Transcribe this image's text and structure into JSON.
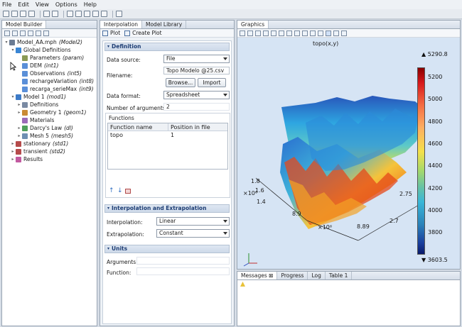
{
  "menu": [
    "File",
    "Edit",
    "View",
    "Options",
    "Help"
  ],
  "model_builder": {
    "tab": "Model Builder",
    "tree": [
      {
        "depth": 0,
        "twisty": "▾",
        "label": "Model_AA.mph",
        "tag": "(Model2)",
        "color": "#6b7c93"
      },
      {
        "depth": 1,
        "twisty": "▾",
        "label": "Global Definitions",
        "tag": "",
        "color": "#3a86d4"
      },
      {
        "depth": 2,
        "twisty": "",
        "label": "Parameters",
        "tag": "(param)",
        "color": "#8a9a55"
      },
      {
        "depth": 2,
        "twisty": "",
        "label": "DEM",
        "tag": "(int1)",
        "color": "#5a8fd8"
      },
      {
        "depth": 2,
        "twisty": "",
        "label": "Observations",
        "tag": "(int5)",
        "color": "#5a8fd8"
      },
      {
        "depth": 2,
        "twisty": "",
        "label": "rechargeVariation",
        "tag": "(int8)",
        "color": "#5a8fd8"
      },
      {
        "depth": 2,
        "twisty": "",
        "label": "recarga_serieMax",
        "tag": "(int9)",
        "color": "#5a8fd8"
      },
      {
        "depth": 1,
        "twisty": "▾",
        "label": "Model 1",
        "tag": "(mod1)",
        "color": "#3c7bc8"
      },
      {
        "depth": 2,
        "twisty": "▸",
        "label": "Definitions",
        "tag": "",
        "color": "#7a8aa3"
      },
      {
        "depth": 2,
        "twisty": "▸",
        "label": "Geometry 1",
        "tag": "(geom1)",
        "color": "#c98a34"
      },
      {
        "depth": 2,
        "twisty": "",
        "label": "Materials",
        "tag": "",
        "color": "#9b6bb8"
      },
      {
        "depth": 2,
        "twisty": "▸",
        "label": "Darcy's Law",
        "tag": "(dl)",
        "color": "#4f9f5b"
      },
      {
        "depth": 2,
        "twisty": "▸",
        "label": "Mesh 5",
        "tag": "(mesh5)",
        "color": "#6e8fb3"
      },
      {
        "depth": 1,
        "twisty": "▸",
        "label": "stationary",
        "tag": "(std1)",
        "color": "#b54b4b"
      },
      {
        "depth": 1,
        "twisty": "▸",
        "label": "transient",
        "tag": "(std2)",
        "color": "#b54b4b"
      },
      {
        "depth": 1,
        "twisty": "▸",
        "label": "Results",
        "tag": "",
        "color": "#c25aa0"
      }
    ]
  },
  "settings": {
    "tabs": [
      "Interpolation",
      "Model Library"
    ],
    "plot_label": "Plot",
    "create_plot_label": "Create Plot",
    "definition": {
      "header": "Definition",
      "data_source_label": "Data source:",
      "data_source_value": "File",
      "filename_label": "Filename:",
      "filename_value": "Topo Modelo @25.csv",
      "browse_label": "Browse...",
      "import_label": "Import",
      "data_format_label": "Data format:",
      "data_format_value": "Spreadsheet",
      "num_args_label": "Number of arguments:",
      "num_args_value": "2",
      "functions_header": "Functions",
      "table_cols": [
        "Function name",
        "Position in file"
      ],
      "table_rows": [
        [
          "topo",
          "1"
        ]
      ]
    },
    "interp": {
      "header": "Interpolation and Extrapolation",
      "interpolation_label": "Interpolation:",
      "interpolation_value": "Linear",
      "extrapolation_label": "Extrapolation:",
      "extrapolation_value": "Constant"
    },
    "units": {
      "header": "Units",
      "arguments_label": "Arguments:",
      "function_label": "Function:"
    }
  },
  "graphics": {
    "tab": "Graphics",
    "plot_title": "topo(x,y)",
    "colorbar_max": "5290.8",
    "colorbar_min": "3603.5",
    "colorbar_ticks": [
      "5200",
      "5000",
      "4800",
      "4600",
      "4400",
      "4200",
      "4000",
      "3800"
    ],
    "axis_y_ticks": [
      "1.8",
      "1.6",
      "1.4"
    ],
    "axis_y_mult": "×10⁶",
    "axis_x_ticks": [
      "8.9",
      "8.89"
    ],
    "axis_x_mult": "×10⁶",
    "axis_z_ticks": [
      "2.75",
      "2.7"
    ]
  },
  "bottom": {
    "tabs": [
      "Messages",
      "Progress",
      "Log",
      "Table 1"
    ]
  }
}
